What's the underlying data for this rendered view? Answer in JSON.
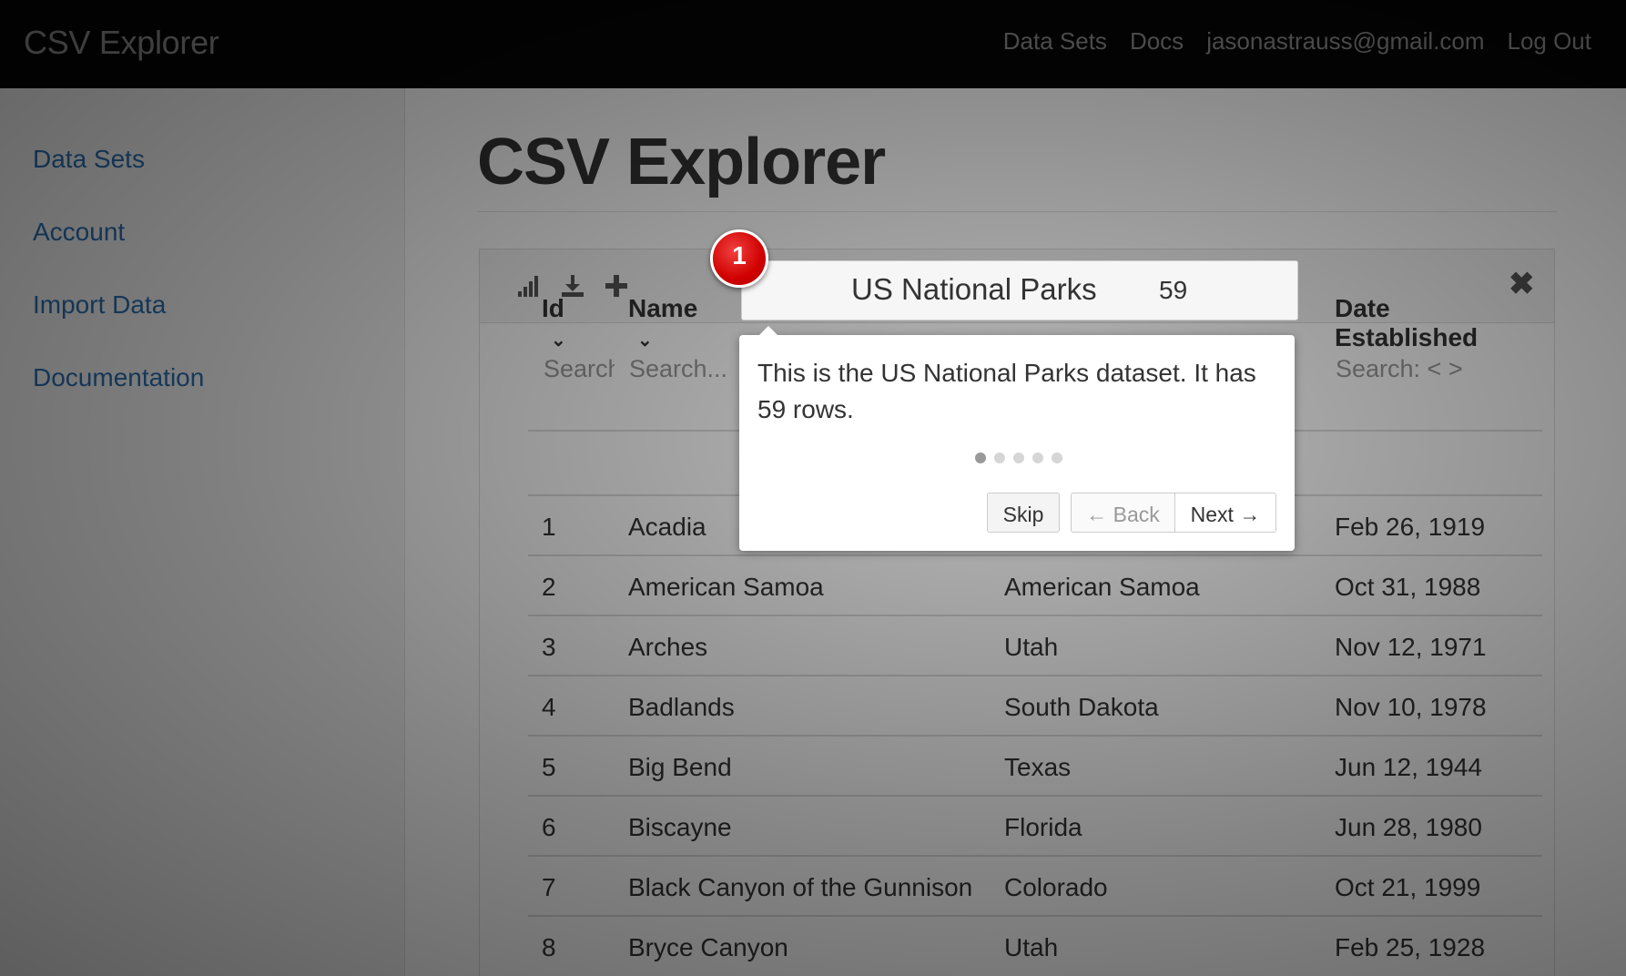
{
  "navbar": {
    "brand": "CSV Explorer",
    "links": [
      "Data Sets",
      "Docs",
      "jasonastrauss@gmail.com",
      "Log Out"
    ]
  },
  "sidebar": {
    "items": [
      "Data Sets",
      "Account",
      "Import Data",
      "Documentation"
    ]
  },
  "main": {
    "title": "CSV Explorer"
  },
  "toolbar": {
    "icons": [
      "bar-chart-icon",
      "download-icon",
      "plus-icon",
      "close-icon"
    ]
  },
  "dataset": {
    "name": "US National Parks",
    "row_count": "59"
  },
  "table": {
    "columns": [
      {
        "label": "Id",
        "search_placeholder": "Search"
      },
      {
        "label": "Name",
        "search_placeholder": "Search..."
      },
      {
        "label": "",
        "search_placeholder": ""
      },
      {
        "label": "Date Established",
        "search_placeholder": "Search: < >"
      }
    ],
    "rows": [
      {
        "id": "1",
        "name": "Acadia",
        "state": "",
        "date": "Feb 26, 1919"
      },
      {
        "id": "2",
        "name": "American Samoa",
        "state": "American Samoa",
        "date": "Oct 31, 1988"
      },
      {
        "id": "3",
        "name": "Arches",
        "state": "Utah",
        "date": "Nov 12, 1971"
      },
      {
        "id": "4",
        "name": "Badlands",
        "state": "South Dakota",
        "date": "Nov 10, 1978"
      },
      {
        "id": "5",
        "name": "Big Bend",
        "state": "Texas",
        "date": "Jun 12, 1944"
      },
      {
        "id": "6",
        "name": "Biscayne",
        "state": "Florida",
        "date": "Jun 28, 1980"
      },
      {
        "id": "7",
        "name": "Black Canyon of the Gunnison",
        "state": "Colorado",
        "date": "Oct 21, 1999"
      },
      {
        "id": "8",
        "name": "Bryce Canyon",
        "state": "Utah",
        "date": "Feb 25, 1928"
      }
    ]
  },
  "tour": {
    "step_badge": "1",
    "message": "This is the US National Parks dataset. It has 59 rows.",
    "total_steps": 5,
    "current_step": 1,
    "skip_label": "Skip",
    "back_label": "← Back",
    "next_label": "Next →"
  }
}
